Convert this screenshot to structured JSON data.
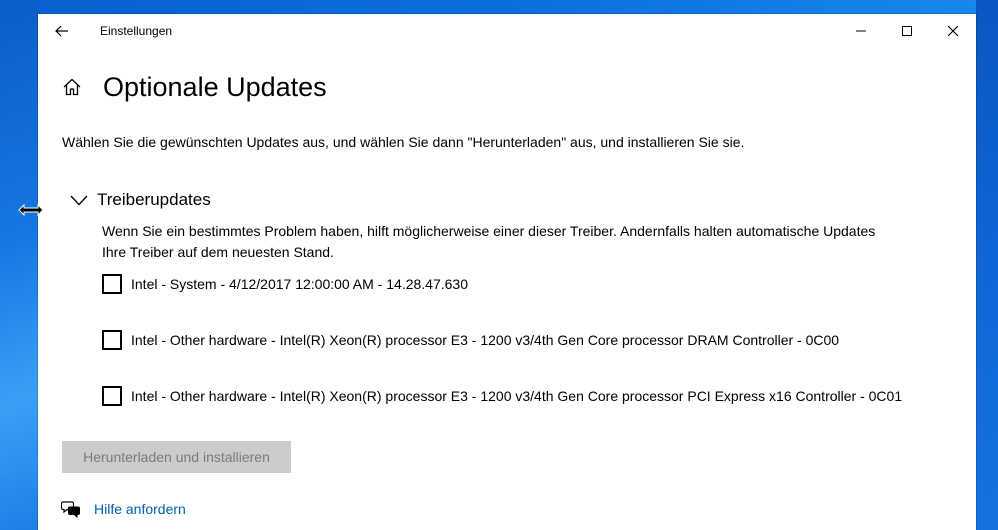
{
  "window": {
    "title": "Einstellungen"
  },
  "page": {
    "title": "Optionale Updates",
    "intro": "Wählen Sie die gewünschten Updates aus, und wählen Sie dann \"Herunterladen\" aus, und installieren Sie sie."
  },
  "section": {
    "title": "Treiberupdates",
    "description": "Wenn Sie ein bestimmtes Problem haben, hilft möglicherweise einer dieser Treiber. Andernfalls halten automatische Updates Ihre Treiber auf dem neuesten Stand.",
    "expanded": true,
    "items": [
      {
        "label": "Intel - System - 4/12/2017 12:00:00 AM - 14.28.47.630",
        "checked": false
      },
      {
        "label": "Intel - Other hardware - Intel(R) Xeon(R) processor E3 - 1200 v3/4th Gen Core processor DRAM Controller - 0C00",
        "checked": false
      },
      {
        "label": "Intel - Other hardware - Intel(R) Xeon(R) processor E3 - 1200 v3/4th Gen Core processor PCI Express x16 Controller - 0C01",
        "checked": false
      }
    ]
  },
  "actions": {
    "download_install_label": "Herunterladen und installieren",
    "download_install_enabled": false
  },
  "help": {
    "label": "Hilfe anfordern"
  },
  "colors": {
    "link": "#0063b1",
    "disabled_button_bg": "#cccccc",
    "disabled_button_text": "#7a7a7a",
    "desktop_blue": "#0b6fe0"
  },
  "icons": {
    "back": "back-arrow-icon",
    "minimize": "minimize-icon",
    "maximize": "maximize-icon",
    "close": "close-icon",
    "home": "home-icon",
    "section_toggle": "chevron-down-icon",
    "help": "chat-bubbles-icon",
    "cursor": "resize-horizontal-cursor-icon"
  }
}
